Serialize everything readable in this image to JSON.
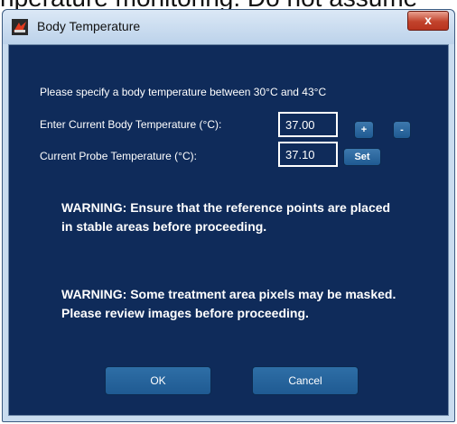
{
  "background_text": "nperature monitoring. Do not assume",
  "window": {
    "title": "Body Temperature",
    "close_label": "x"
  },
  "instructions": "Please specify a body temperature between 30°C and 43°C",
  "body_temp": {
    "label": "Enter Current Body Temperature (°C):",
    "value": "37.00",
    "increment_label": "+",
    "decrement_label": "-"
  },
  "probe_temp": {
    "label": "Current Probe Temperature (°C):",
    "value": "37.10",
    "set_label": "Set"
  },
  "warnings": {
    "reference": "WARNING: Ensure that the reference points are placed in stable areas before proceeding.",
    "masked": "WARNING: Some treatment area pixels may be masked.  Please review images before proceeding."
  },
  "buttons": {
    "ok": "OK",
    "cancel": "Cancel"
  },
  "colors": {
    "client_bg": "#0f2b5a",
    "button_bg": "#1f5a92",
    "close_red": "#c2432c"
  }
}
